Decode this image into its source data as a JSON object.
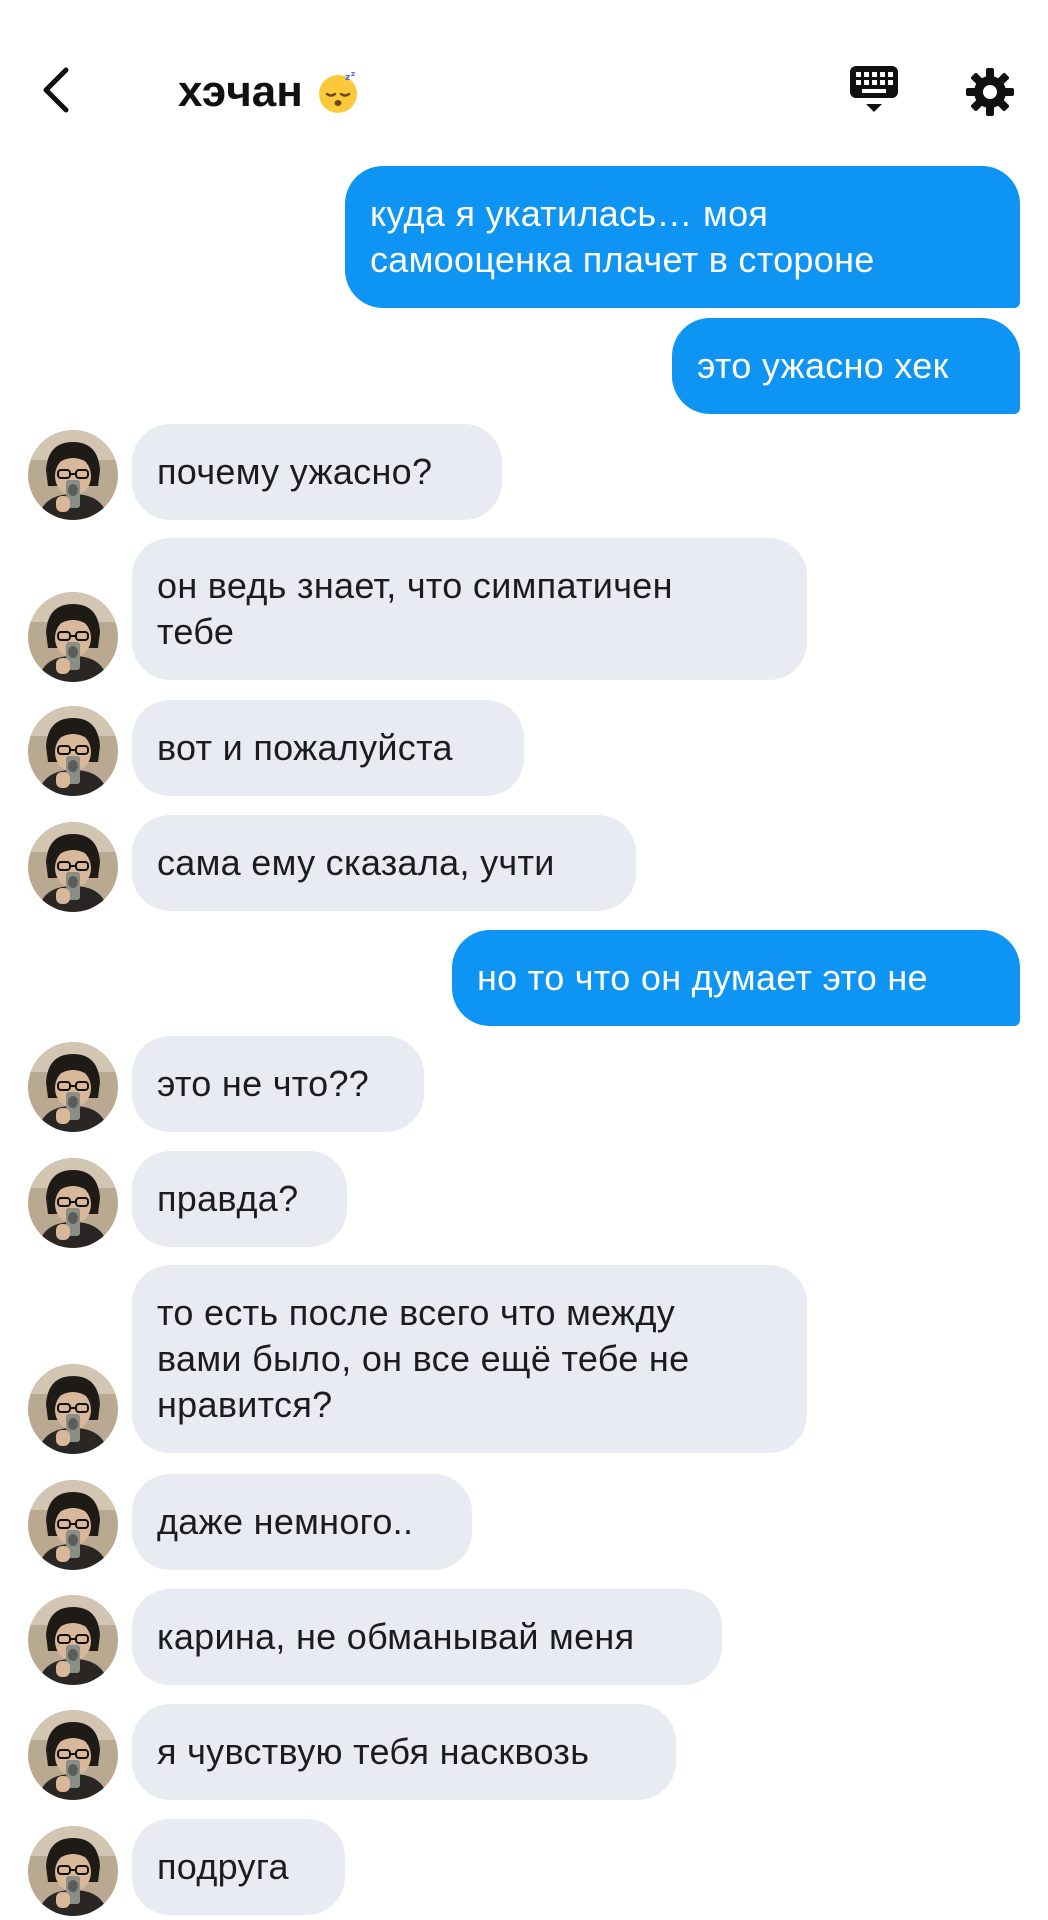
{
  "header": {
    "title": "хэчан",
    "title_emoji": "sleeping-face-emoji",
    "back_icon": "chevron-left-icon",
    "keyboard_icon": "keyboard-icon",
    "settings_icon": "gear-icon"
  },
  "colors": {
    "sent_bubble": "#0e94f3",
    "received_bubble": "#e9ebf2",
    "background": "#ffffff"
  },
  "messages": [
    {
      "side": "sent",
      "text": "куда я укатилась… моя\nсамооценка плачет в стороне"
    },
    {
      "side": "sent",
      "text": "это ужасно хек"
    },
    {
      "side": "received",
      "text": "почему ужасно?"
    },
    {
      "side": "received",
      "text": "он ведь знает, что симпатичен\nтебе"
    },
    {
      "side": "received",
      "text": "вот и пожалуйста"
    },
    {
      "side": "received",
      "text": "сама ему сказала, учти"
    },
    {
      "side": "sent",
      "text": "но то что он думает это не"
    },
    {
      "side": "received",
      "text": "это не что??"
    },
    {
      "side": "received",
      "text": "правда?"
    },
    {
      "side": "received",
      "text": "то есть после всего что между\nвами было, он все ещё тебе не\nнравится?"
    },
    {
      "side": "received",
      "text": "даже немного.."
    },
    {
      "side": "received",
      "text": "карина, не обманывай меня"
    },
    {
      "side": "received",
      "text": "я чувствую тебя насквозь"
    },
    {
      "side": "received",
      "text": "подруга"
    }
  ]
}
